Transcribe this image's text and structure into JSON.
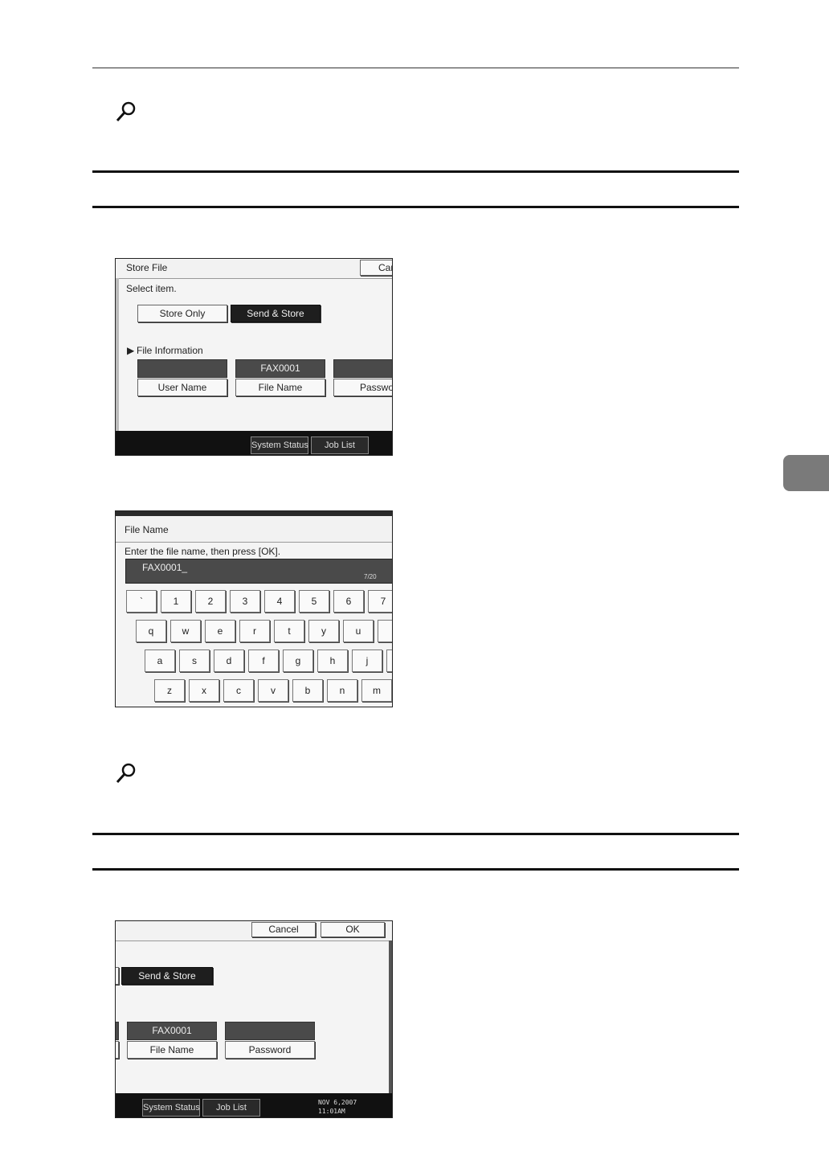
{
  "shot1": {
    "title": "Store File",
    "cancel_partial": "Can",
    "prompt": "Select item.",
    "store_only": "Store Only",
    "send_store": "Send & Store",
    "file_info": "File Information",
    "user_name_value": "",
    "file_name_value": "FAX0001",
    "password_value": "",
    "user_name": "User Name",
    "file_name": "File Name",
    "password_partial": "Passwor",
    "system_status": "System Status",
    "job_list": "Job List"
  },
  "shot2": {
    "title": "File Name",
    "prompt": "Enter the file name, then press [OK].",
    "input_value": "FAX0001_",
    "counter": "7/20",
    "row1": [
      "`",
      "1",
      "2",
      "3",
      "4",
      "5",
      "6",
      "7"
    ],
    "row2": [
      "q",
      "w",
      "e",
      "r",
      "t",
      "y",
      "u",
      ""
    ],
    "row3": [
      "a",
      "s",
      "d",
      "f",
      "g",
      "h",
      "j",
      ""
    ],
    "row4": [
      "z",
      "x",
      "c",
      "v",
      "b",
      "n",
      "m"
    ]
  },
  "shot3": {
    "cancel": "Cancel",
    "ok": "OK",
    "send_store": "Send & Store",
    "file_name_value": "FAX0001",
    "password_value": "",
    "file_name": "File Name",
    "password": "Password",
    "system_status": "System Status",
    "job_list": "Job List",
    "date": "NOV   6,2007",
    "time": "11:01AM"
  },
  "icons": {
    "reference": "magnifier-icon"
  }
}
